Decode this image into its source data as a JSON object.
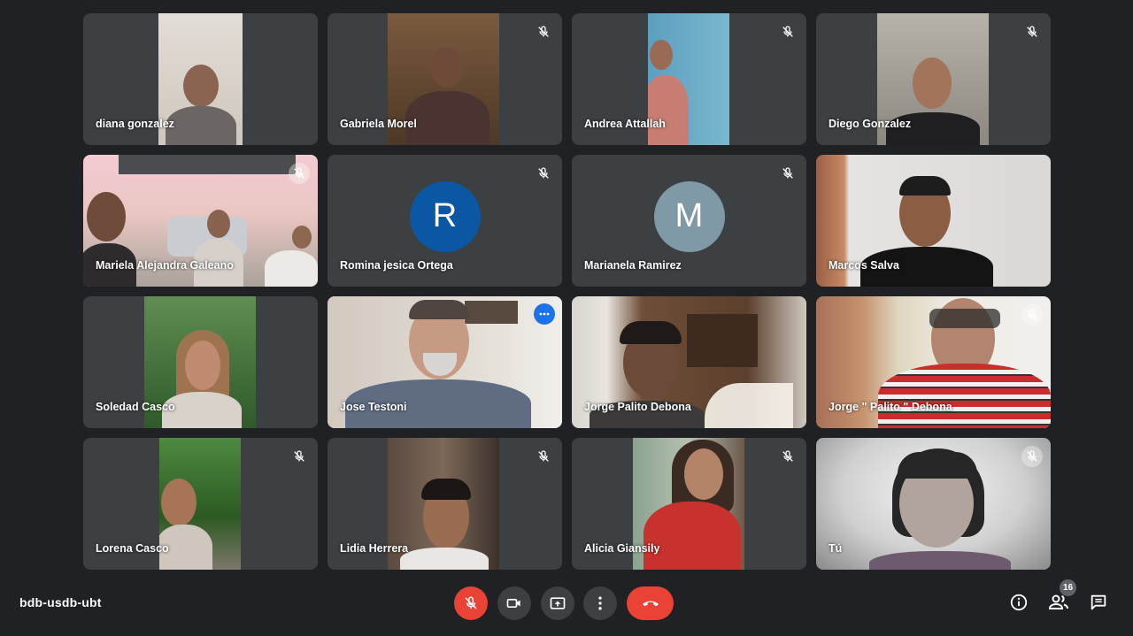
{
  "meeting": {
    "code": "bdb-usdb-ubt",
    "participant_count": "16"
  },
  "participants": [
    {
      "name": "diana gonzalez"
    },
    {
      "name": "Gabriela Morel"
    },
    {
      "name": "Andrea Attallah"
    },
    {
      "name": "Diego Gonzalez"
    },
    {
      "name": "Mariela Alejandra Galeano"
    },
    {
      "name": "Romina jesica Ortega",
      "avatar_letter": "R",
      "avatar_color": "#0b57a4"
    },
    {
      "name": "Marianela Ramirez",
      "avatar_letter": "M",
      "avatar_color": "#7f9aa6"
    },
    {
      "name": "Marcos Salva"
    },
    {
      "name": "Soledad Casco"
    },
    {
      "name": "Jose Testoni"
    },
    {
      "name": "Jorge Palito Debona"
    },
    {
      "name": "Jorge \" Palito \" Debona"
    },
    {
      "name": "Lorena Casco"
    },
    {
      "name": "Lidia Herrera"
    },
    {
      "name": "Alicia Giansily"
    },
    {
      "name": "Tú"
    }
  ],
  "icons": {
    "mic_off": "mic-off-icon",
    "camera": "camera-icon",
    "present": "present-screen-icon",
    "more": "more-vert-icon",
    "hangup": "call-end-icon",
    "info": "info-icon",
    "people": "people-icon",
    "chat": "chat-icon"
  },
  "colors": {
    "background": "#202124",
    "tile": "#3c4043",
    "hangup": "#ea4335",
    "active_outline": "#8ab4f8"
  }
}
